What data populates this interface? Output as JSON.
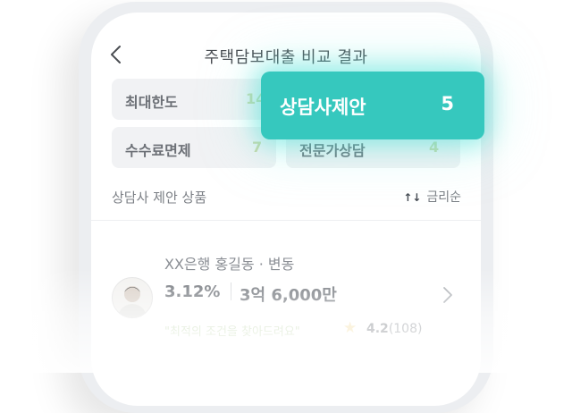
{
  "header": {
    "title": "주택담보대출 비교 결과",
    "back_icon": "chevron-left-icon"
  },
  "summary": {
    "max_limit": {
      "label": "최대한도",
      "count": "14"
    },
    "fee_waiver": {
      "label": "수수료면제",
      "count": "7"
    },
    "expert": {
      "label": "전문가상담",
      "count": "4"
    }
  },
  "highlight": {
    "label": "상담사제안",
    "count": "5",
    "color": "#36c8be"
  },
  "list": {
    "section_title": "상담사 제안 상품",
    "sort_icon": "sort-arrows-icon",
    "sort_label": "금리순",
    "items": [
      {
        "bank": "XX은행 홍길동 · 변동",
        "rate": "3.12%",
        "amount": "3억 6,000만",
        "quote": "\"최적의 조건을 찾아드려요\"",
        "rating": "4.2",
        "reviews": "(108)"
      }
    ]
  }
}
